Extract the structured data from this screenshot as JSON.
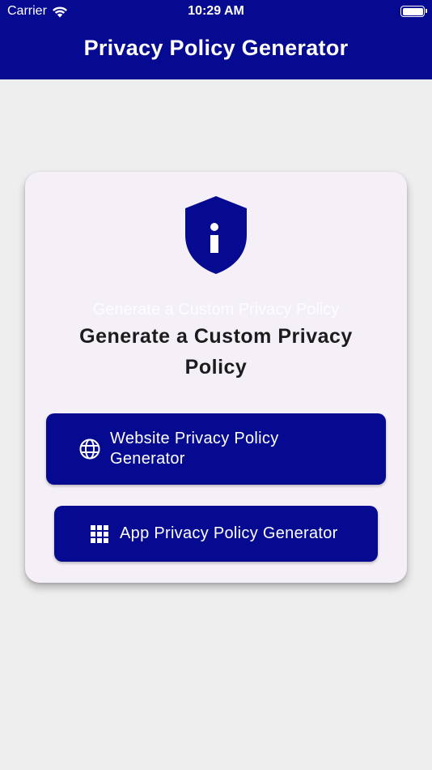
{
  "status_bar": {
    "carrier": "Carrier",
    "time": "10:29 AM"
  },
  "header": {
    "title": "Privacy Policy Generator",
    "background": "#050a91"
  },
  "card": {
    "icon": "shield-info-icon",
    "ghost_heading": "Generate a Custom Privacy Policy",
    "heading": "Generate a Custom Privacy Policy",
    "buttons": [
      {
        "label": "Website Privacy Policy Generator",
        "icon": "globe-icon"
      },
      {
        "label": "App Privacy Policy Generator",
        "icon": "apps-grid-icon"
      }
    ]
  },
  "colors": {
    "primary": "#050a91",
    "page_background": "#eeeeee",
    "card_background": "#f5f0f8"
  }
}
